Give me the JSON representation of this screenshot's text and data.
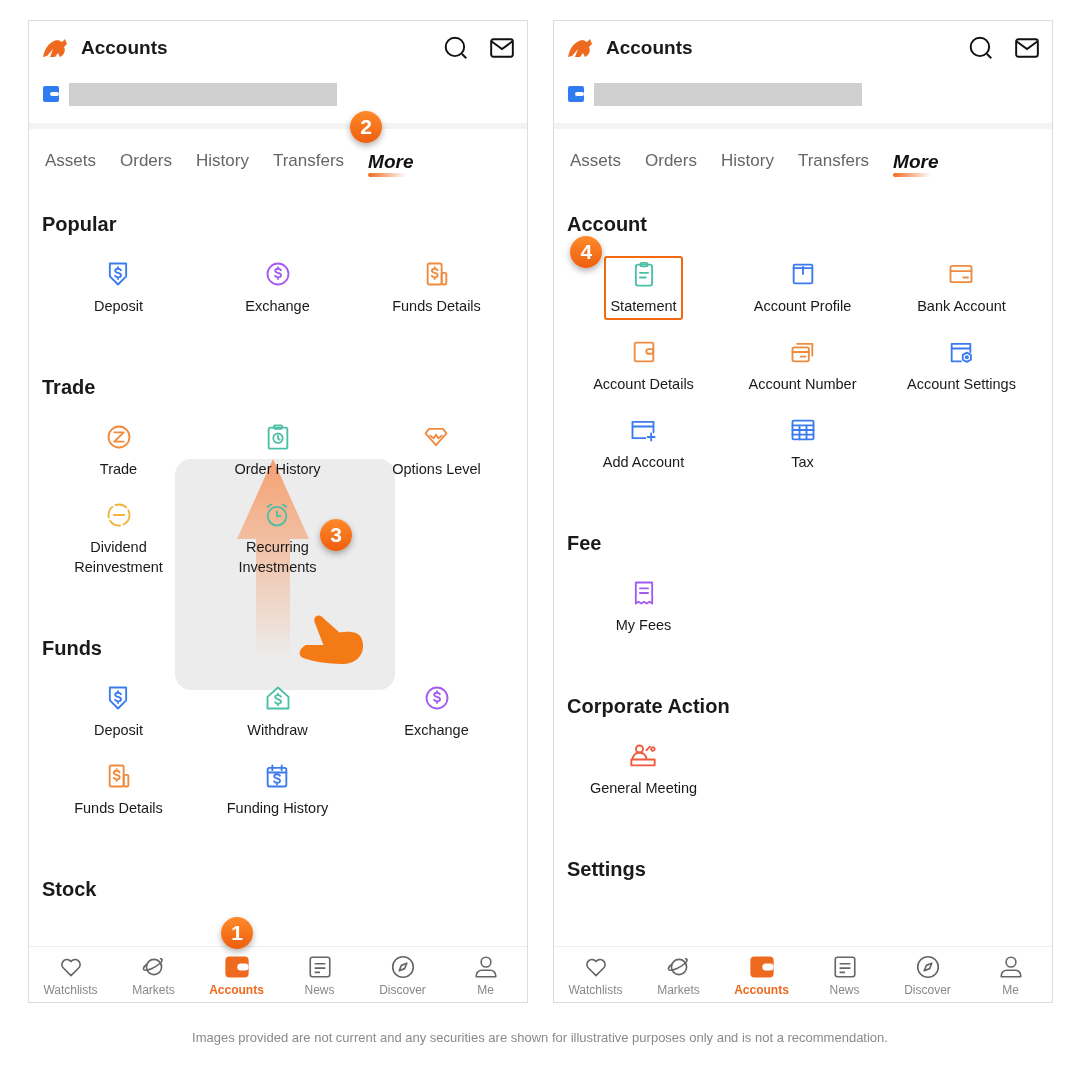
{
  "phones": [
    {
      "title": "Accounts",
      "tabs": [
        {
          "label": "Assets",
          "selected": false
        },
        {
          "label": "Orders",
          "selected": false
        },
        {
          "label": "History",
          "selected": false
        },
        {
          "label": "Transfers",
          "selected": false
        },
        {
          "label": "More",
          "selected": true,
          "step": "2"
        }
      ],
      "sections": [
        {
          "title": "Popular",
          "items": [
            {
              "label": "Deposit",
              "color": "#3b7bf0"
            },
            {
              "label": "Exchange",
              "color": "#a35cf0"
            },
            {
              "label": "Funds Details",
              "color": "#f08a3c"
            }
          ]
        },
        {
          "title": "Trade",
          "items": [
            {
              "label": "Trade",
              "color": "#f08a3c"
            },
            {
              "label": "Order History",
              "color": "#4cbfa6"
            },
            {
              "label": "Options Level",
              "color": "#f08a3c"
            },
            {
              "label": "Dividend Reinvestment",
              "color": "#f0b43c"
            },
            {
              "label": "Recurring Investments",
              "color": "#4cbfa6"
            }
          ]
        },
        {
          "title": "Funds",
          "items": [
            {
              "label": "Deposit",
              "color": "#3b7bf0"
            },
            {
              "label": "Withdraw",
              "color": "#4cbfa6"
            },
            {
              "label": "Exchange",
              "color": "#a35cf0"
            },
            {
              "label": "Funds Details",
              "color": "#f08a3c"
            },
            {
              "label": "Funding History",
              "color": "#3b7bf0"
            }
          ]
        },
        {
          "title": "Stock"
        }
      ],
      "gesture": {
        "kind": "swipe-up",
        "step": "3"
      },
      "nav": [
        {
          "label": "Watchlists",
          "selected": false
        },
        {
          "label": "Markets",
          "selected": false
        },
        {
          "label": "Accounts",
          "selected": true,
          "step": "1"
        },
        {
          "label": "News",
          "selected": false
        },
        {
          "label": "Discover",
          "selected": false
        },
        {
          "label": "Me",
          "selected": false
        }
      ]
    },
    {
      "title": "Accounts",
      "tabs": [
        {
          "label": "Assets",
          "selected": false
        },
        {
          "label": "Orders",
          "selected": false
        },
        {
          "label": "History",
          "selected": false
        },
        {
          "label": "Transfers",
          "selected": false
        },
        {
          "label": "More",
          "selected": true
        }
      ],
      "sections": [
        {
          "title": "Account",
          "items": [
            {
              "label": "Statement",
              "color": "#4cbfa6",
              "highlighted": true,
              "step": "4"
            },
            {
              "label": "Account Profile",
              "color": "#3b7bf0",
              "highlighted": false
            },
            {
              "label": "Bank Account",
              "color": "#f08a3c",
              "highlighted": false
            },
            {
              "label": "Account Details",
              "color": "#f08a3c",
              "highlighted": false
            },
            {
              "label": "Account Number",
              "color": "#f08a3c",
              "highlighted": false
            },
            {
              "label": "Account Settings",
              "color": "#3b7bf0",
              "highlighted": false
            },
            {
              "label": "Add Account",
              "color": "#3b7bf0",
              "highlighted": false
            },
            {
              "label": "Tax",
              "color": "#3b7bf0",
              "highlighted": false
            }
          ]
        },
        {
          "title": "Fee",
          "items": [
            {
              "label": "My Fees",
              "color": "#a35cf0",
              "highlighted": false
            }
          ]
        },
        {
          "title": "Corporate Action",
          "items": [
            {
              "label": "General Meeting",
              "color": "#ee5a3c",
              "highlighted": false
            }
          ]
        },
        {
          "title": "Settings"
        }
      ],
      "nav": [
        {
          "label": "Watchlists",
          "selected": false
        },
        {
          "label": "Markets",
          "selected": false
        },
        {
          "label": "Accounts",
          "selected": true
        },
        {
          "label": "News",
          "selected": false
        },
        {
          "label": "Discover",
          "selected": false
        },
        {
          "label": "Me",
          "selected": false
        }
      ]
    }
  ],
  "disclaimer": "Images provided are not current and any securities are shown for illustrative purposes only and is not a recommendation."
}
